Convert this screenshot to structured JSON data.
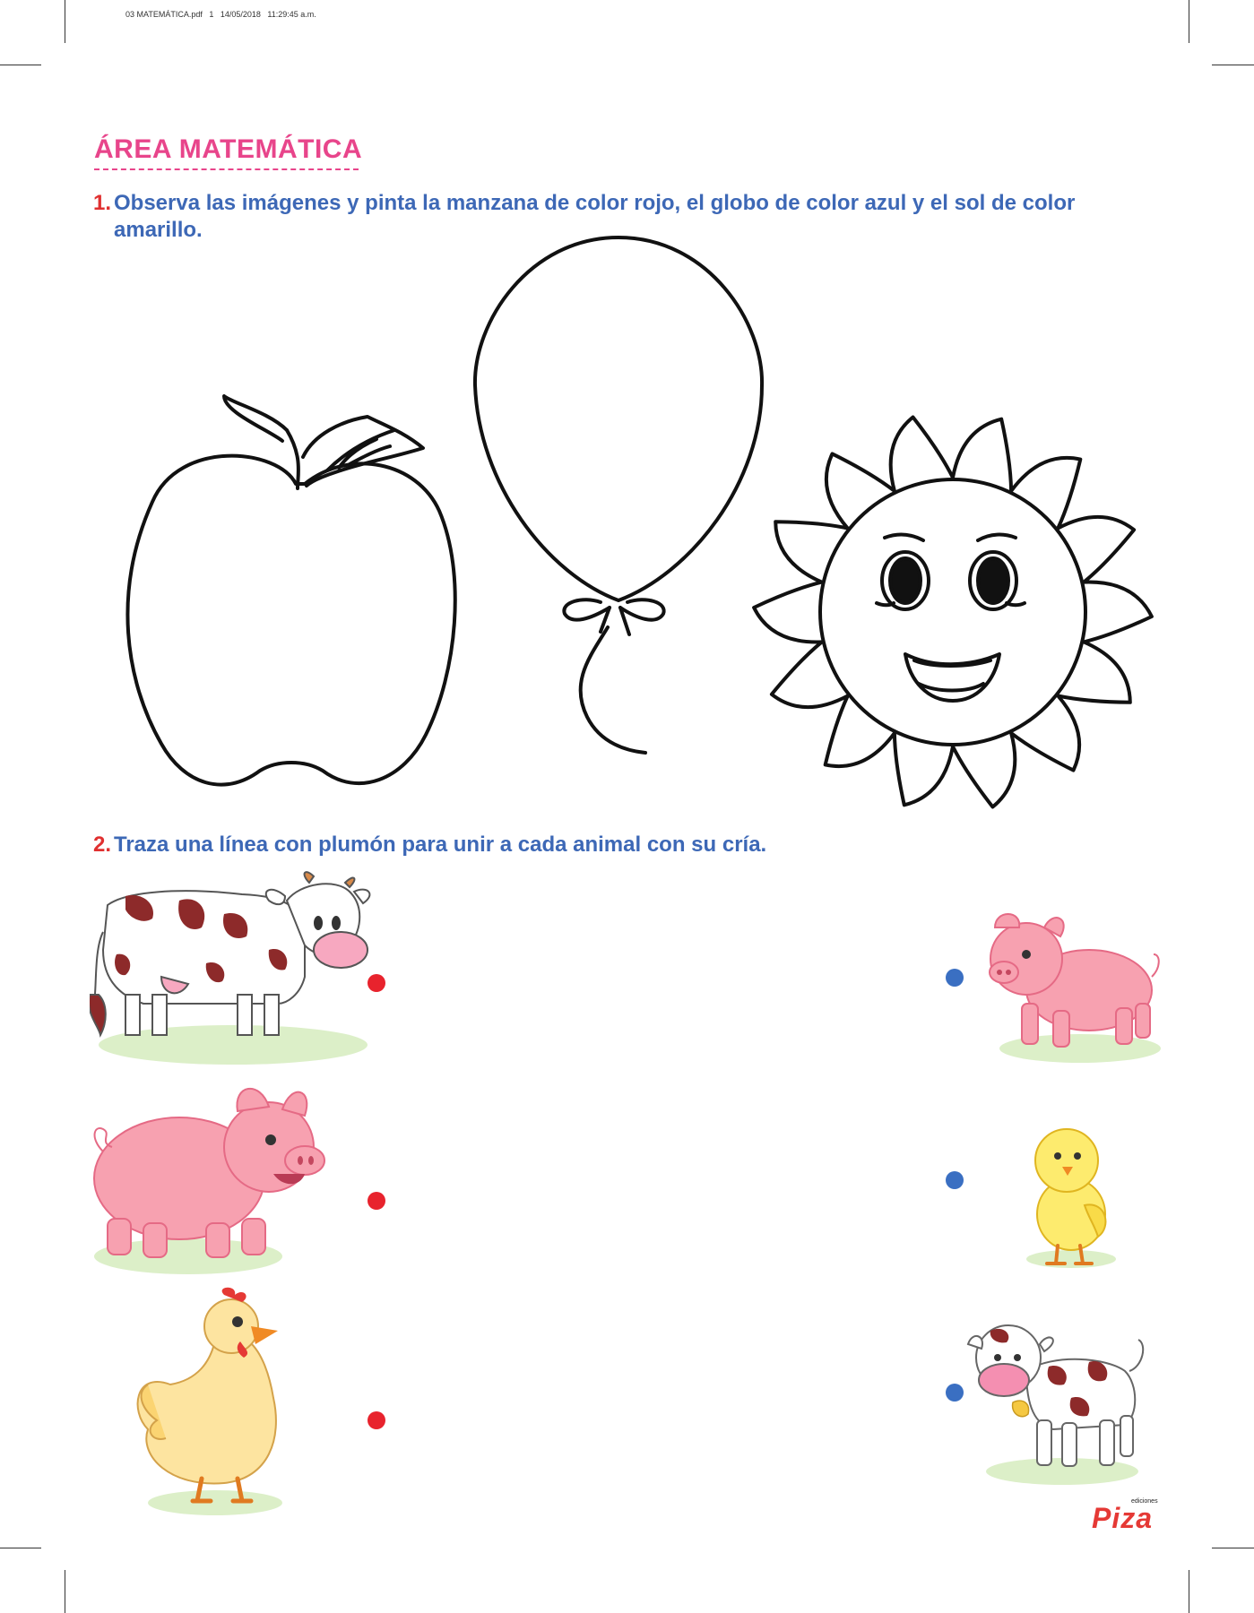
{
  "header": {
    "meta": "03 MATEMÁTICA.pdf   1   14/05/2018   11:29:45 a.m."
  },
  "section": {
    "title": "ÁREA MATEMÁTICA"
  },
  "q1": {
    "number": "1.",
    "line1": "Observa las imágenes y pinta la manzana de color rojo, el globo de color azul y el sol de color",
    "line2": "amarillo."
  },
  "q2": {
    "number": "2.",
    "text": "Traza una línea con plumón para unir a cada animal con su cría."
  },
  "colors": {
    "title_pink": "#e8458b",
    "instruction_blue": "#3d68b6",
    "number_red": "#e03030",
    "dot_red": "#e8232d",
    "dot_blue": "#3a6fc2"
  },
  "icons": {
    "q1": [
      "apple-outline",
      "balloon-outline",
      "sun-outline"
    ],
    "q2_left": [
      "cow",
      "pig",
      "hen"
    ],
    "q2_right": [
      "piglet",
      "chick",
      "calf"
    ]
  },
  "logo": {
    "small": "ediciones",
    "main": "Piza"
  }
}
